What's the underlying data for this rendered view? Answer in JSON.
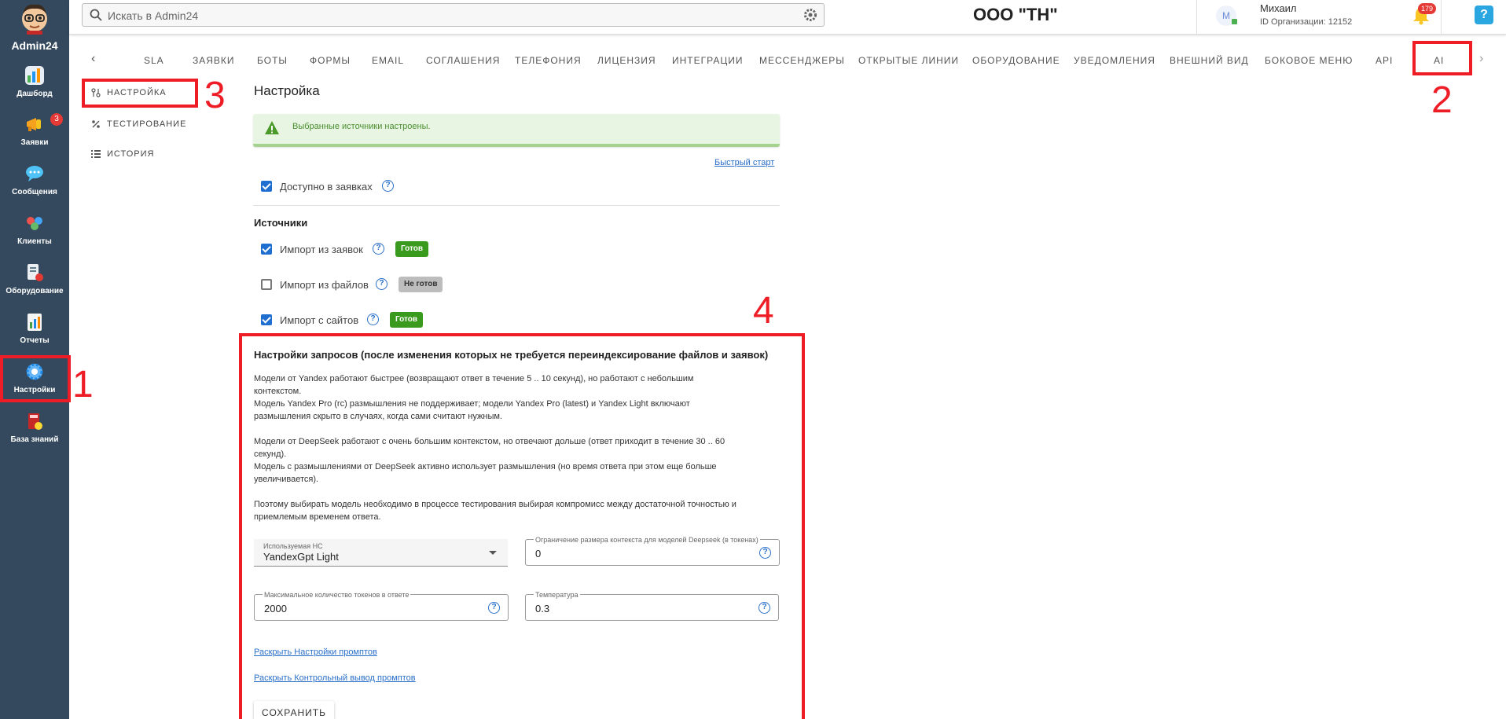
{
  "app": {
    "brand": "Admin24",
    "org_name": "ООО \"ТН\""
  },
  "sidebar": {
    "items": [
      {
        "label": "Дашборд",
        "icon": "dashboard-icon"
      },
      {
        "label": "Заявки",
        "icon": "megaphone-icon",
        "badge": "3"
      },
      {
        "label": "Сообщения",
        "icon": "chat-icon"
      },
      {
        "label": "Клиенты",
        "icon": "clients-icon"
      },
      {
        "label": "Оборудование",
        "icon": "equipment-icon"
      },
      {
        "label": "Отчеты",
        "icon": "reports-icon"
      },
      {
        "label": "Настройки",
        "icon": "gear-icon"
      },
      {
        "label": "База знаний",
        "icon": "knowledge-base-icon"
      }
    ]
  },
  "topbar": {
    "search_placeholder": "Искать в Admin24",
    "user_initial": "M",
    "user_name": "Михаил",
    "user_org_id": "ID Организации: 12152",
    "notifications_count": "179",
    "help_label": "?"
  },
  "tabs": [
    "SLA",
    "Заявки",
    "Боты",
    "Формы",
    "Email",
    "Соглашения",
    "Телефония",
    "Лицензия",
    "Интеграции",
    "Мессенджеры",
    "Открытые линии",
    "Оборудование",
    "Уведомления",
    "Внешний вид",
    "Боковое меню",
    "API",
    "AI"
  ],
  "submenu": [
    {
      "label": "Настройка",
      "icon": "settings-sliders-icon"
    },
    {
      "label": "Тестирование",
      "icon": "percent-icon"
    },
    {
      "label": "История",
      "icon": "list-icon"
    }
  ],
  "annotations": [
    "1",
    "2",
    "3",
    "4"
  ],
  "main": {
    "title": "Настройка",
    "alert_text": "Выбранные источники настроены.",
    "quickstart_link": "Быстрый старт",
    "available_in_requests": {
      "label": "Доступно в заявках",
      "checked": true
    },
    "sources_title": "Источники",
    "sources": [
      {
        "label": "Импорт из заявок",
        "checked": true,
        "status": "Готов"
      },
      {
        "label": "Импорт из файлов",
        "checked": false,
        "status": "Не готов"
      },
      {
        "label": "Импорт с сайтов",
        "checked": true,
        "status": "Готов"
      }
    ],
    "request_settings": {
      "title": "Настройки запросов (после изменения которых не требуется переиндексирование файлов и заявок)",
      "lines": [
        "Модели от Yandex работают быстрее (возвращают ответ в течение 5 .. 10 секунд), но работают с небольшим",
        "контекстом.",
        "Модель Yandex Pro (rc) размышления не поддерживает; модели Yandex Pro (latest) и Yandex Light включают",
        "размышления скрыто в случаях, когда сами считают нужным.",
        "Модели от DeepSeek работают с очень большим контекстом, но отвечают дольше (ответ приходит в течение 30 .. 60",
        "секунд).",
        "Модель с размышлениями от DeepSeek активно использует размышления (но время ответа при этом еще больше",
        "увеличивается).",
        "Поэтому выбирать модель необходимо в процессе тестирования выбирая компромисс между достаточной точностью и",
        "приемлемым временем ответа."
      ],
      "model_label": "Используемая НС",
      "model_value": "YandexGpt Light",
      "context_limit_label": "Ограничение размера контекста для моделей Deepseek (в токенах)",
      "context_limit_value": "0",
      "max_tokens_label": "Максимальное количество токенов в ответе",
      "max_tokens_value": "2000",
      "temperature_label": "Температура",
      "temperature_value": "0.3",
      "expand_prompts_link": "Раскрыть Настройки промптов",
      "expand_control_output_link": "Раскрыть Контрольный вывод промптов",
      "save_label": "СОХРАНИТЬ"
    }
  },
  "colors": {
    "sidebar_bg": "#34495e",
    "accent": "#1f6fd1",
    "annotation_red": "#ee1c25",
    "ready_green": "#3a9a1d"
  }
}
